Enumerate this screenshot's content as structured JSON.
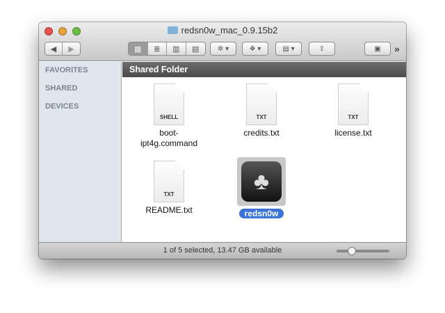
{
  "window": {
    "title": "redsn0w_mac_0.9.15b2"
  },
  "toolbar": {
    "back": "◀",
    "forward": "▶",
    "view_icons": "▦",
    "view_list": "≣",
    "view_columns": "▥",
    "view_coverflow": "▤",
    "action": "✲ ▾",
    "dropbox": "❖ ▾",
    "arrange": "▤ ▾",
    "share": "⇪",
    "new_folder": "▣",
    "overflow": "»"
  },
  "sidebar": {
    "sections": [
      "FAVORITES",
      "SHARED",
      "DEVICES"
    ]
  },
  "header": {
    "title": "Shared Folder"
  },
  "files": [
    {
      "name": "boot-\nipt4g.command",
      "line1": "boot-",
      "line2": "ipt4g.command",
      "type": "SHELL"
    },
    {
      "name": "credits.txt",
      "type": "TXT"
    },
    {
      "name": "license.txt",
      "type": "TXT"
    },
    {
      "name": "README.txt",
      "type": "TXT"
    },
    {
      "name": "redsn0w",
      "type": "app",
      "selected": true
    }
  ],
  "status": {
    "text": "1 of 5 selected, 13.47 GB available",
    "zoom_fraction": 0.25
  }
}
